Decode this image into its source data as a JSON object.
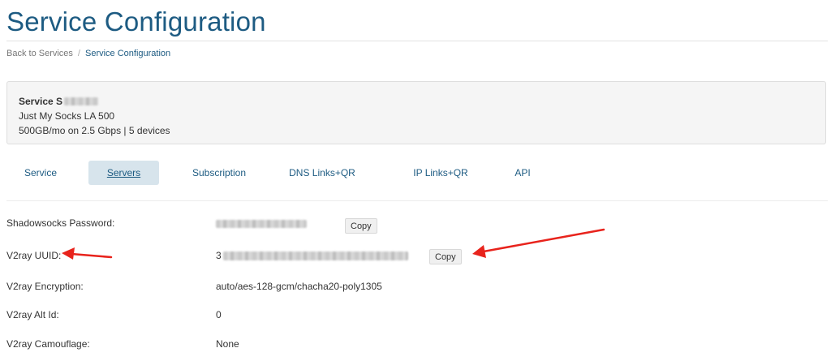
{
  "page": {
    "title": "Service Configuration"
  },
  "breadcrumb": {
    "back_label": "Back to Services",
    "separator": "/",
    "current_label": "Service Configuration"
  },
  "service": {
    "name": "Service S",
    "plan": "Just My Socks LA 500",
    "details": "500GB/mo on 2.5 Gbps | 5 devices"
  },
  "tabs": [
    {
      "label": "Service",
      "active": false
    },
    {
      "label": "Servers",
      "active": true
    },
    {
      "label": "Subscription",
      "active": false
    },
    {
      "label": "DNS Links+QR",
      "active": false
    },
    {
      "label": "IP Links+QR",
      "active": false
    },
    {
      "label": "API",
      "active": false
    }
  ],
  "config": {
    "shadowsocks_password": {
      "label": "Shadowsocks Password:",
      "copy_label": "Copy"
    },
    "v2ray_uuid": {
      "label": "V2ray UUID:",
      "value_prefix": "3",
      "copy_label": "Copy"
    },
    "v2ray_encryption": {
      "label": "V2ray Encryption:",
      "value": "auto/aes-128-gcm/chacha20-poly1305"
    },
    "v2ray_alt_id": {
      "label": "V2ray Alt Id:",
      "value": "0"
    },
    "v2ray_camouflage": {
      "label": "V2ray Camouflage:",
      "value": "None"
    }
  },
  "colors": {
    "accent": "#1d5b82",
    "active_tab_bg": "#d7e4ec",
    "annotation_arrow": "#e8231c"
  }
}
